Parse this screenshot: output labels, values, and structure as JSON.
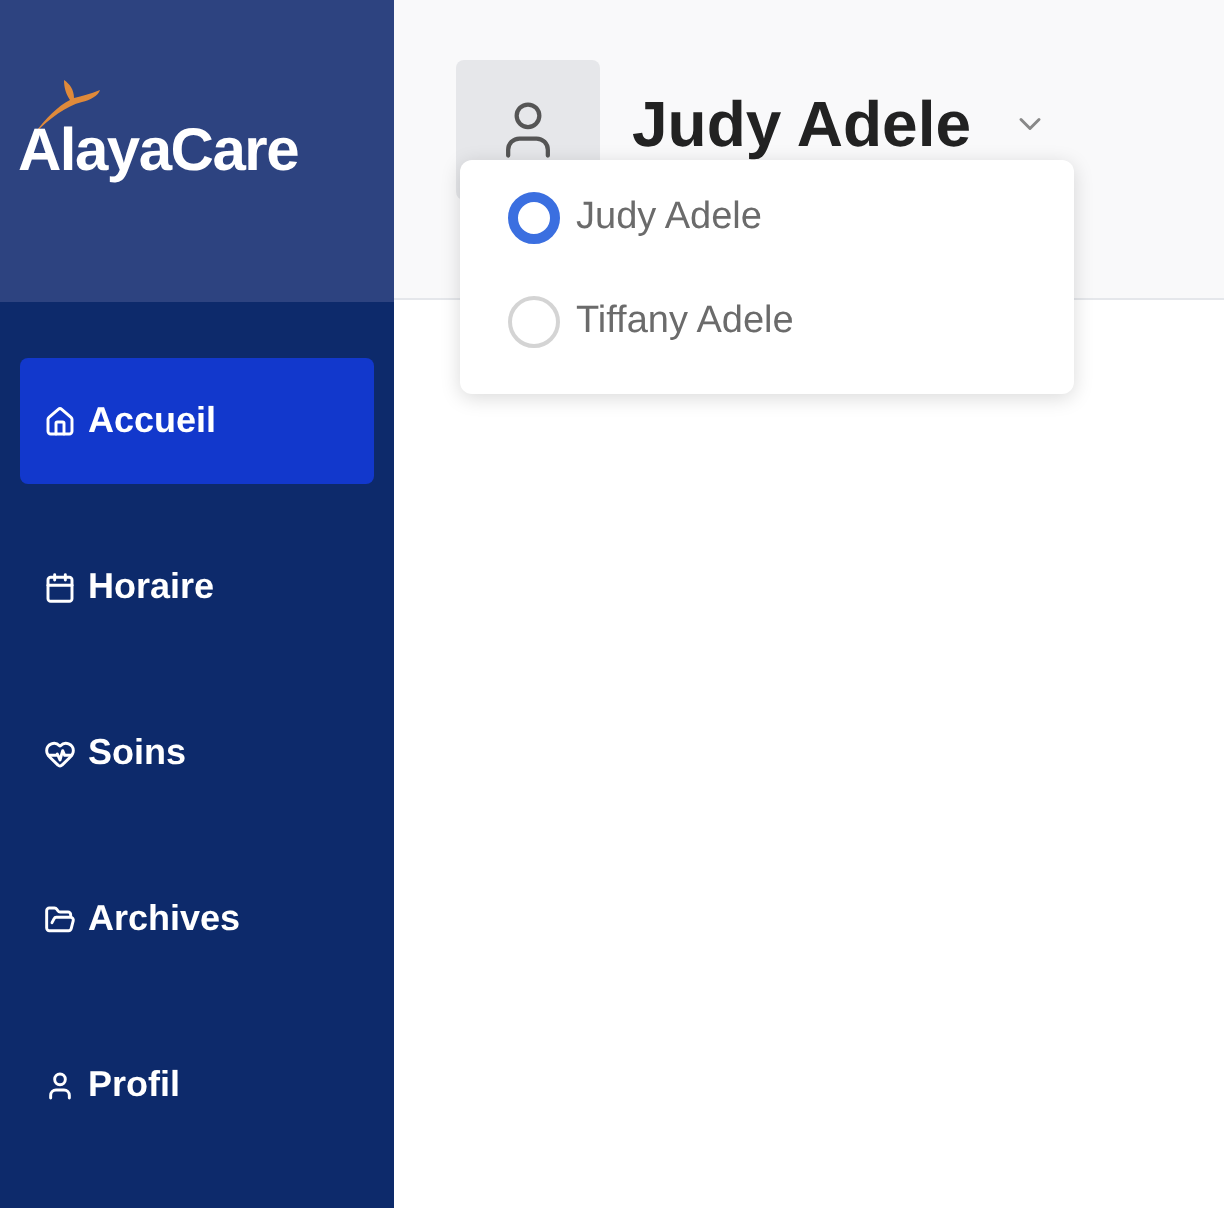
{
  "sidebar": {
    "logo": "AlayaCare",
    "items": [
      {
        "label": "Accueil",
        "selected": true
      },
      {
        "label": "Horaire",
        "selected": false
      },
      {
        "label": "Soins",
        "selected": false
      },
      {
        "label": "Archives",
        "selected": false
      },
      {
        "label": "Profil",
        "selected": false
      }
    ]
  },
  "header": {
    "name": "Judy Adele"
  },
  "dropdown": {
    "options": [
      {
        "label": "Judy Adele",
        "selected": true
      },
      {
        "label": "Tiffany Adele",
        "selected": false
      }
    ]
  }
}
